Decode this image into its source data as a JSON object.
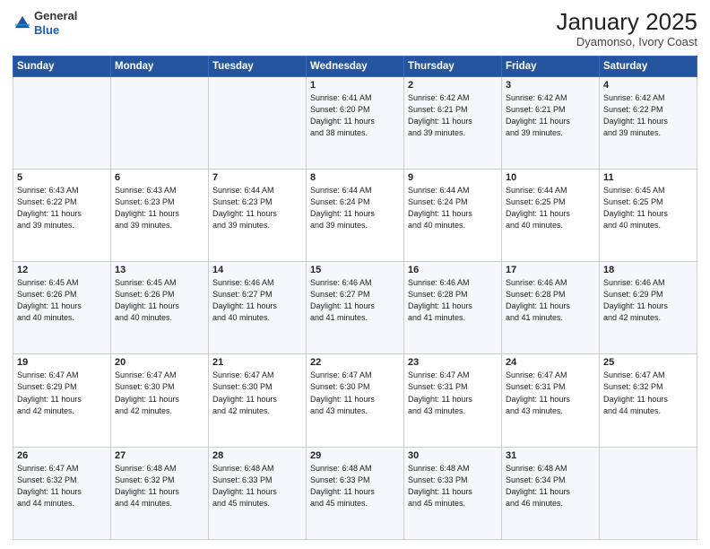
{
  "header": {
    "logo_general": "General",
    "logo_blue": "Blue",
    "month_year": "January 2025",
    "location": "Dyamonso, Ivory Coast"
  },
  "days_of_week": [
    "Sunday",
    "Monday",
    "Tuesday",
    "Wednesday",
    "Thursday",
    "Friday",
    "Saturday"
  ],
  "weeks": [
    [
      {
        "day": "",
        "info": ""
      },
      {
        "day": "",
        "info": ""
      },
      {
        "day": "",
        "info": ""
      },
      {
        "day": "1",
        "info": "Sunrise: 6:41 AM\nSunset: 6:20 PM\nDaylight: 11 hours\nand 38 minutes."
      },
      {
        "day": "2",
        "info": "Sunrise: 6:42 AM\nSunset: 6:21 PM\nDaylight: 11 hours\nand 39 minutes."
      },
      {
        "day": "3",
        "info": "Sunrise: 6:42 AM\nSunset: 6:21 PM\nDaylight: 11 hours\nand 39 minutes."
      },
      {
        "day": "4",
        "info": "Sunrise: 6:42 AM\nSunset: 6:22 PM\nDaylight: 11 hours\nand 39 minutes."
      }
    ],
    [
      {
        "day": "5",
        "info": "Sunrise: 6:43 AM\nSunset: 6:22 PM\nDaylight: 11 hours\nand 39 minutes."
      },
      {
        "day": "6",
        "info": "Sunrise: 6:43 AM\nSunset: 6:23 PM\nDaylight: 11 hours\nand 39 minutes."
      },
      {
        "day": "7",
        "info": "Sunrise: 6:44 AM\nSunset: 6:23 PM\nDaylight: 11 hours\nand 39 minutes."
      },
      {
        "day": "8",
        "info": "Sunrise: 6:44 AM\nSunset: 6:24 PM\nDaylight: 11 hours\nand 39 minutes."
      },
      {
        "day": "9",
        "info": "Sunrise: 6:44 AM\nSunset: 6:24 PM\nDaylight: 11 hours\nand 40 minutes."
      },
      {
        "day": "10",
        "info": "Sunrise: 6:44 AM\nSunset: 6:25 PM\nDaylight: 11 hours\nand 40 minutes."
      },
      {
        "day": "11",
        "info": "Sunrise: 6:45 AM\nSunset: 6:25 PM\nDaylight: 11 hours\nand 40 minutes."
      }
    ],
    [
      {
        "day": "12",
        "info": "Sunrise: 6:45 AM\nSunset: 6:26 PM\nDaylight: 11 hours\nand 40 minutes."
      },
      {
        "day": "13",
        "info": "Sunrise: 6:45 AM\nSunset: 6:26 PM\nDaylight: 11 hours\nand 40 minutes."
      },
      {
        "day": "14",
        "info": "Sunrise: 6:46 AM\nSunset: 6:27 PM\nDaylight: 11 hours\nand 40 minutes."
      },
      {
        "day": "15",
        "info": "Sunrise: 6:46 AM\nSunset: 6:27 PM\nDaylight: 11 hours\nand 41 minutes."
      },
      {
        "day": "16",
        "info": "Sunrise: 6:46 AM\nSunset: 6:28 PM\nDaylight: 11 hours\nand 41 minutes."
      },
      {
        "day": "17",
        "info": "Sunrise: 6:46 AM\nSunset: 6:28 PM\nDaylight: 11 hours\nand 41 minutes."
      },
      {
        "day": "18",
        "info": "Sunrise: 6:46 AM\nSunset: 6:29 PM\nDaylight: 11 hours\nand 42 minutes."
      }
    ],
    [
      {
        "day": "19",
        "info": "Sunrise: 6:47 AM\nSunset: 6:29 PM\nDaylight: 11 hours\nand 42 minutes."
      },
      {
        "day": "20",
        "info": "Sunrise: 6:47 AM\nSunset: 6:30 PM\nDaylight: 11 hours\nand 42 minutes."
      },
      {
        "day": "21",
        "info": "Sunrise: 6:47 AM\nSunset: 6:30 PM\nDaylight: 11 hours\nand 42 minutes."
      },
      {
        "day": "22",
        "info": "Sunrise: 6:47 AM\nSunset: 6:30 PM\nDaylight: 11 hours\nand 43 minutes."
      },
      {
        "day": "23",
        "info": "Sunrise: 6:47 AM\nSunset: 6:31 PM\nDaylight: 11 hours\nand 43 minutes."
      },
      {
        "day": "24",
        "info": "Sunrise: 6:47 AM\nSunset: 6:31 PM\nDaylight: 11 hours\nand 43 minutes."
      },
      {
        "day": "25",
        "info": "Sunrise: 6:47 AM\nSunset: 6:32 PM\nDaylight: 11 hours\nand 44 minutes."
      }
    ],
    [
      {
        "day": "26",
        "info": "Sunrise: 6:47 AM\nSunset: 6:32 PM\nDaylight: 11 hours\nand 44 minutes."
      },
      {
        "day": "27",
        "info": "Sunrise: 6:48 AM\nSunset: 6:32 PM\nDaylight: 11 hours\nand 44 minutes."
      },
      {
        "day": "28",
        "info": "Sunrise: 6:48 AM\nSunset: 6:33 PM\nDaylight: 11 hours\nand 45 minutes."
      },
      {
        "day": "29",
        "info": "Sunrise: 6:48 AM\nSunset: 6:33 PM\nDaylight: 11 hours\nand 45 minutes."
      },
      {
        "day": "30",
        "info": "Sunrise: 6:48 AM\nSunset: 6:33 PM\nDaylight: 11 hours\nand 45 minutes."
      },
      {
        "day": "31",
        "info": "Sunrise: 6:48 AM\nSunset: 6:34 PM\nDaylight: 11 hours\nand 46 minutes."
      },
      {
        "day": "",
        "info": ""
      }
    ]
  ]
}
